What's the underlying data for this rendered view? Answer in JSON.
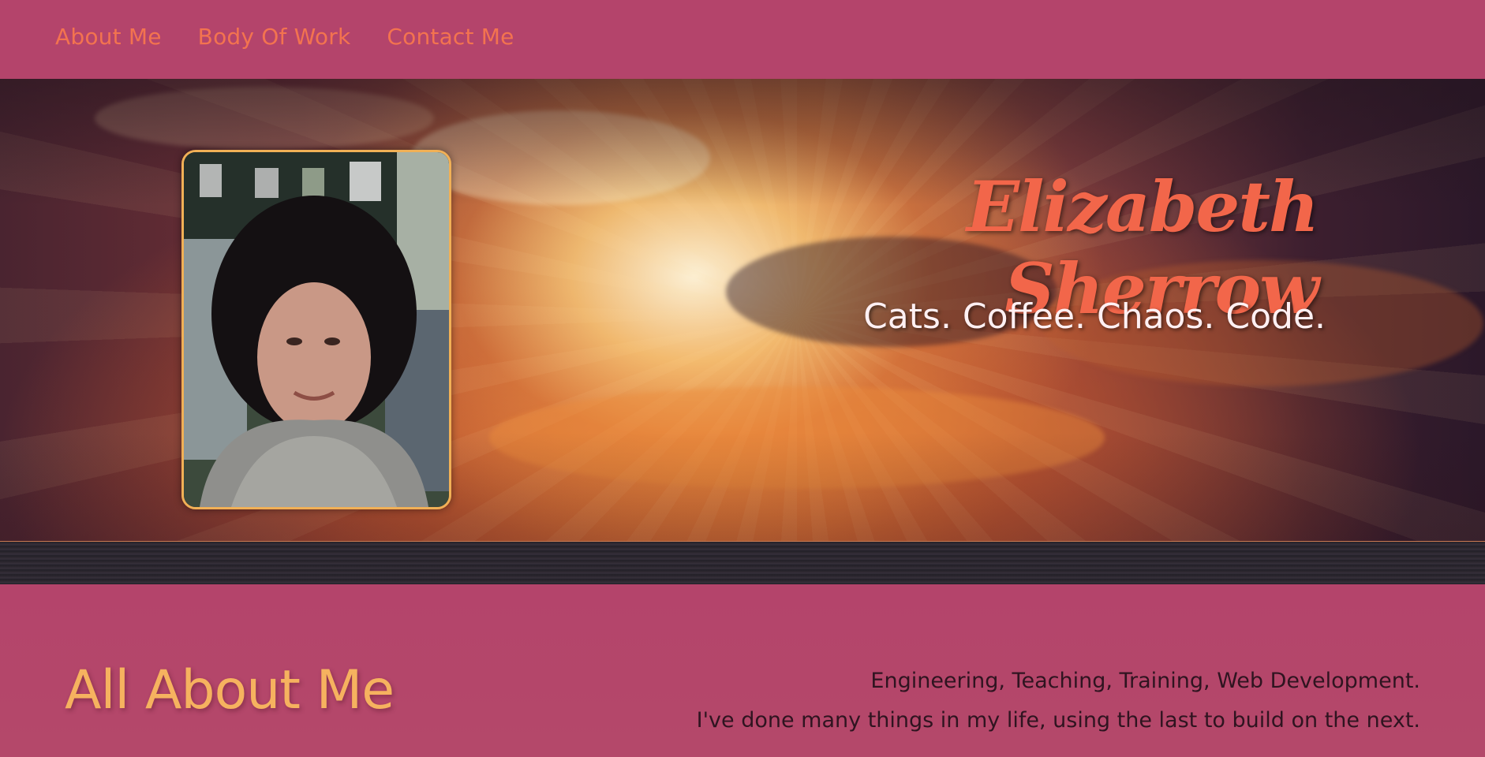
{
  "nav": {
    "items": [
      {
        "label": "About Me"
      },
      {
        "label": "Body Of Work"
      },
      {
        "label": "Contact Me"
      }
    ]
  },
  "hero": {
    "title": "Elizabeth Sherrow",
    "tagline": "Cats. Coffee. Chaos. Code."
  },
  "about": {
    "heading": "All About Me",
    "line1": "Engineering, Teaching, Training, Web Development.",
    "line2": "I've done many things in my life, using the last to build on the next."
  },
  "colors": {
    "nav_background": "#b4446b",
    "nav_link": "#f3734f",
    "title": "#f2664a",
    "tagline": "#fff0f3",
    "heading": "#f6b25f",
    "body_text": "#2f1420",
    "portrait_border": "#f1b056"
  }
}
